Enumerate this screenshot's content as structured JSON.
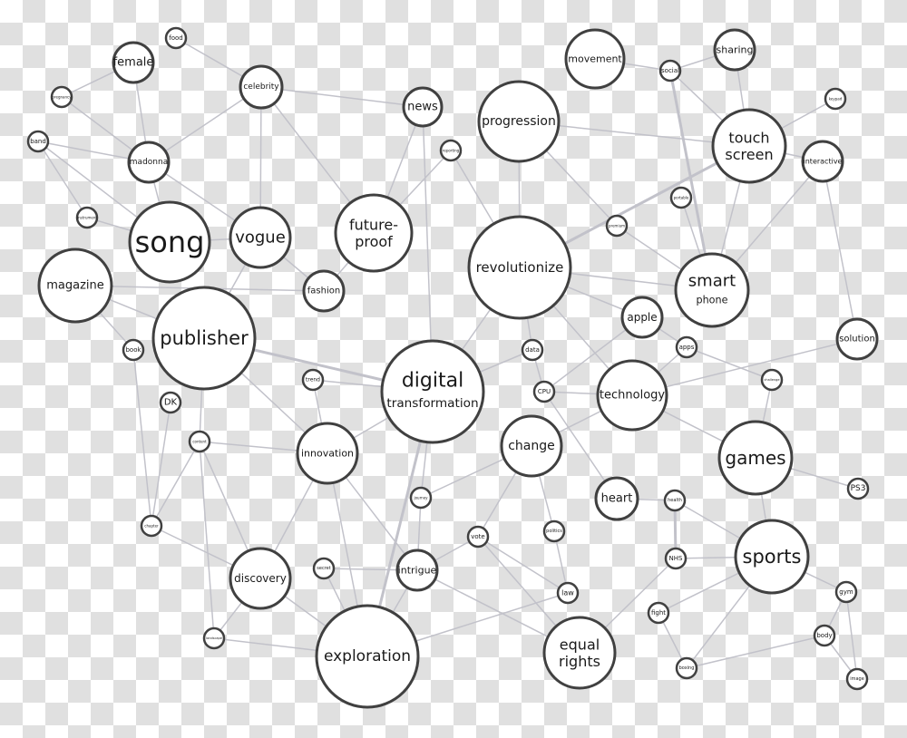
{
  "nodes": [
    {
      "id": "food",
      "lines": [
        "food"
      ]
    },
    {
      "id": "female",
      "lines": [
        "female"
      ]
    },
    {
      "id": "celebrity",
      "lines": [
        "celebrity"
      ]
    },
    {
      "id": "pregnancy",
      "lines": [
        "pregnancy"
      ]
    },
    {
      "id": "band",
      "lines": [
        "band"
      ]
    },
    {
      "id": "madonna",
      "lines": [
        "madonna"
      ]
    },
    {
      "id": "instrument",
      "lines": [
        "instrument"
      ]
    },
    {
      "id": "song",
      "lines": [
        "song"
      ]
    },
    {
      "id": "vogue",
      "lines": [
        "vogue"
      ]
    },
    {
      "id": "magazine",
      "lines": [
        "magazine"
      ]
    },
    {
      "id": "publisher",
      "lines": [
        "publisher"
      ]
    },
    {
      "id": "fashion",
      "lines": [
        "fashion"
      ]
    },
    {
      "id": "future-proof",
      "lines": [
        "future-",
        "proof"
      ]
    },
    {
      "id": "news",
      "lines": [
        "news"
      ]
    },
    {
      "id": "reporting",
      "lines": [
        "reporting"
      ]
    },
    {
      "id": "progression",
      "lines": [
        "progression"
      ]
    },
    {
      "id": "movement",
      "lines": [
        "movement"
      ]
    },
    {
      "id": "social",
      "lines": [
        "social"
      ]
    },
    {
      "id": "sharing",
      "lines": [
        "sharing"
      ]
    },
    {
      "id": "keypad",
      "lines": [
        "keypad"
      ]
    },
    {
      "id": "touch-screen",
      "lines": [
        "touch",
        "screen"
      ]
    },
    {
      "id": "interactive",
      "lines": [
        "interactive"
      ]
    },
    {
      "id": "portable",
      "lines": [
        "portable"
      ]
    },
    {
      "id": "premium",
      "lines": [
        "premium"
      ]
    },
    {
      "id": "revolutionize",
      "lines": [
        "revolutionize"
      ]
    },
    {
      "id": "smart-phone",
      "lines": [
        "smart",
        "phone"
      ]
    },
    {
      "id": "apple",
      "lines": [
        "apple"
      ]
    },
    {
      "id": "apps",
      "lines": [
        "apps"
      ]
    },
    {
      "id": "solution",
      "lines": [
        "solution"
      ]
    },
    {
      "id": "data",
      "lines": [
        "data"
      ]
    },
    {
      "id": "book",
      "lines": [
        "book"
      ]
    },
    {
      "id": "digital-transformation",
      "lines": [
        "digital",
        "transformation"
      ]
    },
    {
      "id": "trend",
      "lines": [
        "trend"
      ]
    },
    {
      "id": "DK",
      "lines": [
        "DK"
      ]
    },
    {
      "id": "CPU",
      "lines": [
        "CPU"
      ]
    },
    {
      "id": "technology",
      "lines": [
        "technology"
      ]
    },
    {
      "id": "challenge",
      "lines": [
        "challenge"
      ]
    },
    {
      "id": "content",
      "lines": [
        "content"
      ]
    },
    {
      "id": "innovation",
      "lines": [
        "innovation"
      ]
    },
    {
      "id": "change",
      "lines": [
        "change"
      ]
    },
    {
      "id": "games",
      "lines": [
        "games"
      ]
    },
    {
      "id": "heart",
      "lines": [
        "heart"
      ]
    },
    {
      "id": "journey",
      "lines": [
        "journey"
      ]
    },
    {
      "id": "health",
      "lines": [
        "health"
      ]
    },
    {
      "id": "PS3",
      "lines": [
        "PS3"
      ]
    },
    {
      "id": "chapter",
      "lines": [
        "chapter"
      ]
    },
    {
      "id": "vote",
      "lines": [
        "vote"
      ]
    },
    {
      "id": "politics",
      "lines": [
        "politics"
      ]
    },
    {
      "id": "sports",
      "lines": [
        "sports"
      ]
    },
    {
      "id": "NHS",
      "lines": [
        "NHS"
      ]
    },
    {
      "id": "secret",
      "lines": [
        "secret"
      ]
    },
    {
      "id": "intrigue",
      "lines": [
        "intrigue"
      ]
    },
    {
      "id": "discovery",
      "lines": [
        "discovery"
      ]
    },
    {
      "id": "law",
      "lines": [
        "law"
      ]
    },
    {
      "id": "gym",
      "lines": [
        "gym"
      ]
    },
    {
      "id": "fight",
      "lines": [
        "fight"
      ]
    },
    {
      "id": "body",
      "lines": [
        "body"
      ]
    },
    {
      "id": "equal-rights",
      "lines": [
        "equal",
        "rights"
      ]
    },
    {
      "id": "exploration",
      "lines": [
        "exploration"
      ]
    },
    {
      "id": "landscape",
      "lines": [
        "landscape"
      ]
    },
    {
      "id": "boxing",
      "lines": [
        "boxing"
      ]
    },
    {
      "id": "image",
      "lines": [
        "image"
      ]
    }
  ],
  "edges": [
    [
      "food",
      "celebrity"
    ],
    [
      "female",
      "pregnancy"
    ],
    [
      "female",
      "madonna"
    ],
    [
      "pregnancy",
      "madonna"
    ],
    [
      "band",
      "madonna"
    ],
    [
      "band",
      "song"
    ],
    [
      "band",
      "instrument"
    ],
    [
      "madonna",
      "celebrity"
    ],
    [
      "madonna",
      "song"
    ],
    [
      "madonna",
      "vogue"
    ],
    [
      "celebrity",
      "vogue"
    ],
    [
      "celebrity",
      "news"
    ],
    [
      "celebrity",
      "future-proof"
    ],
    [
      "instrument",
      "song"
    ],
    [
      "song",
      "vogue"
    ],
    [
      "magazine",
      "fashion"
    ],
    [
      "magazine",
      "publisher"
    ],
    [
      "magazine",
      "book"
    ],
    [
      "vogue",
      "fashion"
    ],
    [
      "vogue",
      "publisher"
    ],
    [
      "future-proof",
      "news"
    ],
    [
      "future-proof",
      "reporting"
    ],
    [
      "future-proof",
      "fashion"
    ],
    [
      "news",
      "digital-transformation"
    ],
    [
      "reporting",
      "revolutionize"
    ],
    [
      "progression",
      "revolutionize"
    ],
    [
      "progression",
      "touch-screen"
    ],
    [
      "progression",
      "premium"
    ],
    [
      "movement",
      "social"
    ],
    [
      "social",
      "sharing"
    ],
    [
      "social",
      "touch-screen"
    ],
    [
      "social",
      "smart-phone"
    ],
    [
      "sharing",
      "touch-screen"
    ],
    [
      "keypad",
      "touch-screen"
    ],
    [
      "touch-screen",
      "interactive"
    ],
    [
      "touch-screen",
      "smart-phone"
    ],
    [
      "touch-screen",
      "revolutionize"
    ],
    [
      "interactive",
      "smart-phone"
    ],
    [
      "interactive",
      "solution"
    ],
    [
      "portable",
      "smart-phone"
    ],
    [
      "premium",
      "smart-phone"
    ],
    [
      "revolutionize",
      "smart-phone"
    ],
    [
      "revolutionize",
      "apple"
    ],
    [
      "revolutionize",
      "technology"
    ],
    [
      "revolutionize",
      "data"
    ],
    [
      "revolutionize",
      "digital-transformation"
    ],
    [
      "apple",
      "apps"
    ],
    [
      "apple",
      "CPU"
    ],
    [
      "apps",
      "challenge"
    ],
    [
      "apps",
      "technology"
    ],
    [
      "solution",
      "technology"
    ],
    [
      "data",
      "CPU"
    ],
    [
      "data",
      "digital-transformation"
    ],
    [
      "CPU",
      "technology"
    ],
    [
      "CPU",
      "heart"
    ],
    [
      "technology",
      "change"
    ],
    [
      "technology",
      "games"
    ],
    [
      "challenge",
      "games"
    ],
    [
      "publisher",
      "digital-transformation"
    ],
    [
      "publisher",
      "innovation"
    ],
    [
      "publisher",
      "content"
    ],
    [
      "book",
      "chapter"
    ],
    [
      "DK",
      "chapter"
    ],
    [
      "content",
      "chapter"
    ],
    [
      "content",
      "innovation"
    ],
    [
      "content",
      "discovery"
    ],
    [
      "content",
      "landscape"
    ],
    [
      "trend",
      "innovation"
    ],
    [
      "trend",
      "digital-transformation"
    ],
    [
      "innovation",
      "digital-transformation"
    ],
    [
      "innovation",
      "discovery"
    ],
    [
      "innovation",
      "exploration"
    ],
    [
      "innovation",
      "intrigue"
    ],
    [
      "digital-transformation",
      "journey"
    ],
    [
      "digital-transformation",
      "exploration"
    ],
    [
      "change",
      "journey"
    ],
    [
      "change",
      "vote"
    ],
    [
      "change",
      "politics"
    ],
    [
      "journey",
      "intrigue"
    ],
    [
      "vote",
      "intrigue"
    ],
    [
      "vote",
      "law"
    ],
    [
      "vote",
      "equal-rights"
    ],
    [
      "politics",
      "law"
    ],
    [
      "law",
      "exploration"
    ],
    [
      "secret",
      "intrigue"
    ],
    [
      "secret",
      "exploration"
    ],
    [
      "intrigue",
      "exploration"
    ],
    [
      "intrigue",
      "equal-rights"
    ],
    [
      "discovery",
      "chapter"
    ],
    [
      "discovery",
      "exploration"
    ],
    [
      "discovery",
      "landscape"
    ],
    [
      "landscape",
      "exploration"
    ],
    [
      "games",
      "PS3"
    ],
    [
      "games",
      "sports"
    ],
    [
      "health",
      "NHS"
    ],
    [
      "health",
      "sports"
    ],
    [
      "health",
      "heart"
    ],
    [
      "NHS",
      "sports"
    ],
    [
      "NHS",
      "equal-rights"
    ],
    [
      "sports",
      "fight"
    ],
    [
      "sports",
      "boxing"
    ],
    [
      "sports",
      "gym"
    ],
    [
      "gym",
      "body"
    ],
    [
      "gym",
      "image"
    ],
    [
      "body",
      "image"
    ],
    [
      "body",
      "boxing"
    ],
    [
      "fight",
      "boxing"
    ]
  ],
  "colors": {
    "node_stroke": "#404040",
    "edge": "#c2c2ca",
    "checker_dark": "#e0e0e0",
    "checker_light": "#ffffff"
  }
}
